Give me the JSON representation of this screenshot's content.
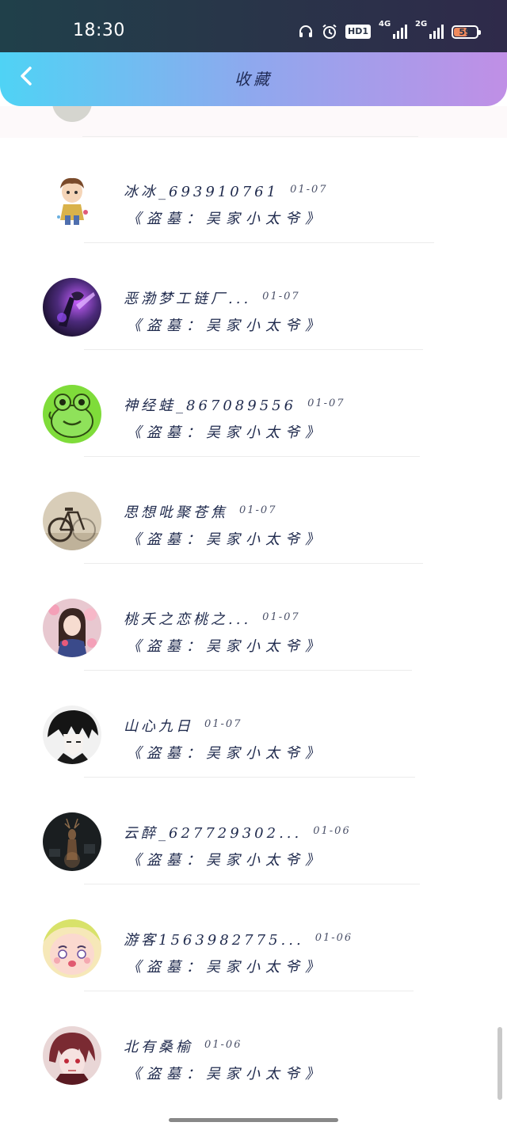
{
  "status_bar": {
    "time": "18:30",
    "hd_label": "HD1",
    "net1_label": "4G",
    "net2_label": "2G",
    "battery_percent": "59",
    "battery_level": 0.59,
    "icons": [
      "headphones-icon",
      "alarm-icon",
      "hd-icon",
      "signal-4g-icon",
      "signal-2g-icon",
      "battery-icon"
    ]
  },
  "header": {
    "title": "收藏",
    "back_icon": "chevron-left-icon"
  },
  "items": [
    {
      "name": "冰冰_693910761",
      "date": "01-07",
      "title": "《盗墓：吴家小太爷》",
      "avatar": "boy-cartoon"
    },
    {
      "name": "恶渤梦工链厂...",
      "date": "01-07",
      "title": "《盗墓：吴家小太爷》",
      "avatar": "purple-warrior"
    },
    {
      "name": "神经蛙_867089556",
      "date": "01-07",
      "title": "《盗墓：吴家小太爷》",
      "avatar": "green-frog"
    },
    {
      "name": "思想吡聚苍焦",
      "date": "01-07",
      "title": "《盗墓：吴家小太爷》",
      "avatar": "bicycle"
    },
    {
      "name": "桃夭之恋桃之...",
      "date": "01-07",
      "title": "《盗墓：吴家小太爷》",
      "avatar": "girl-flowers"
    },
    {
      "name": "山心九日",
      "date": "01-07",
      "title": "《盗墓：吴家小太爷》",
      "avatar": "anime-boy-dark"
    },
    {
      "name": "云醉_627729302...",
      "date": "01-06",
      "title": "《盗墓：吴家小太爷》",
      "avatar": "deer-dark"
    },
    {
      "name": "游客1563982775...",
      "date": "01-06",
      "title": "《盗墓：吴家小太爷》",
      "avatar": "baby-face"
    },
    {
      "name": "北有桑榆",
      "date": "01-06",
      "title": "《盗墓：吴家小太爷》",
      "avatar": "anime-red"
    }
  ]
}
